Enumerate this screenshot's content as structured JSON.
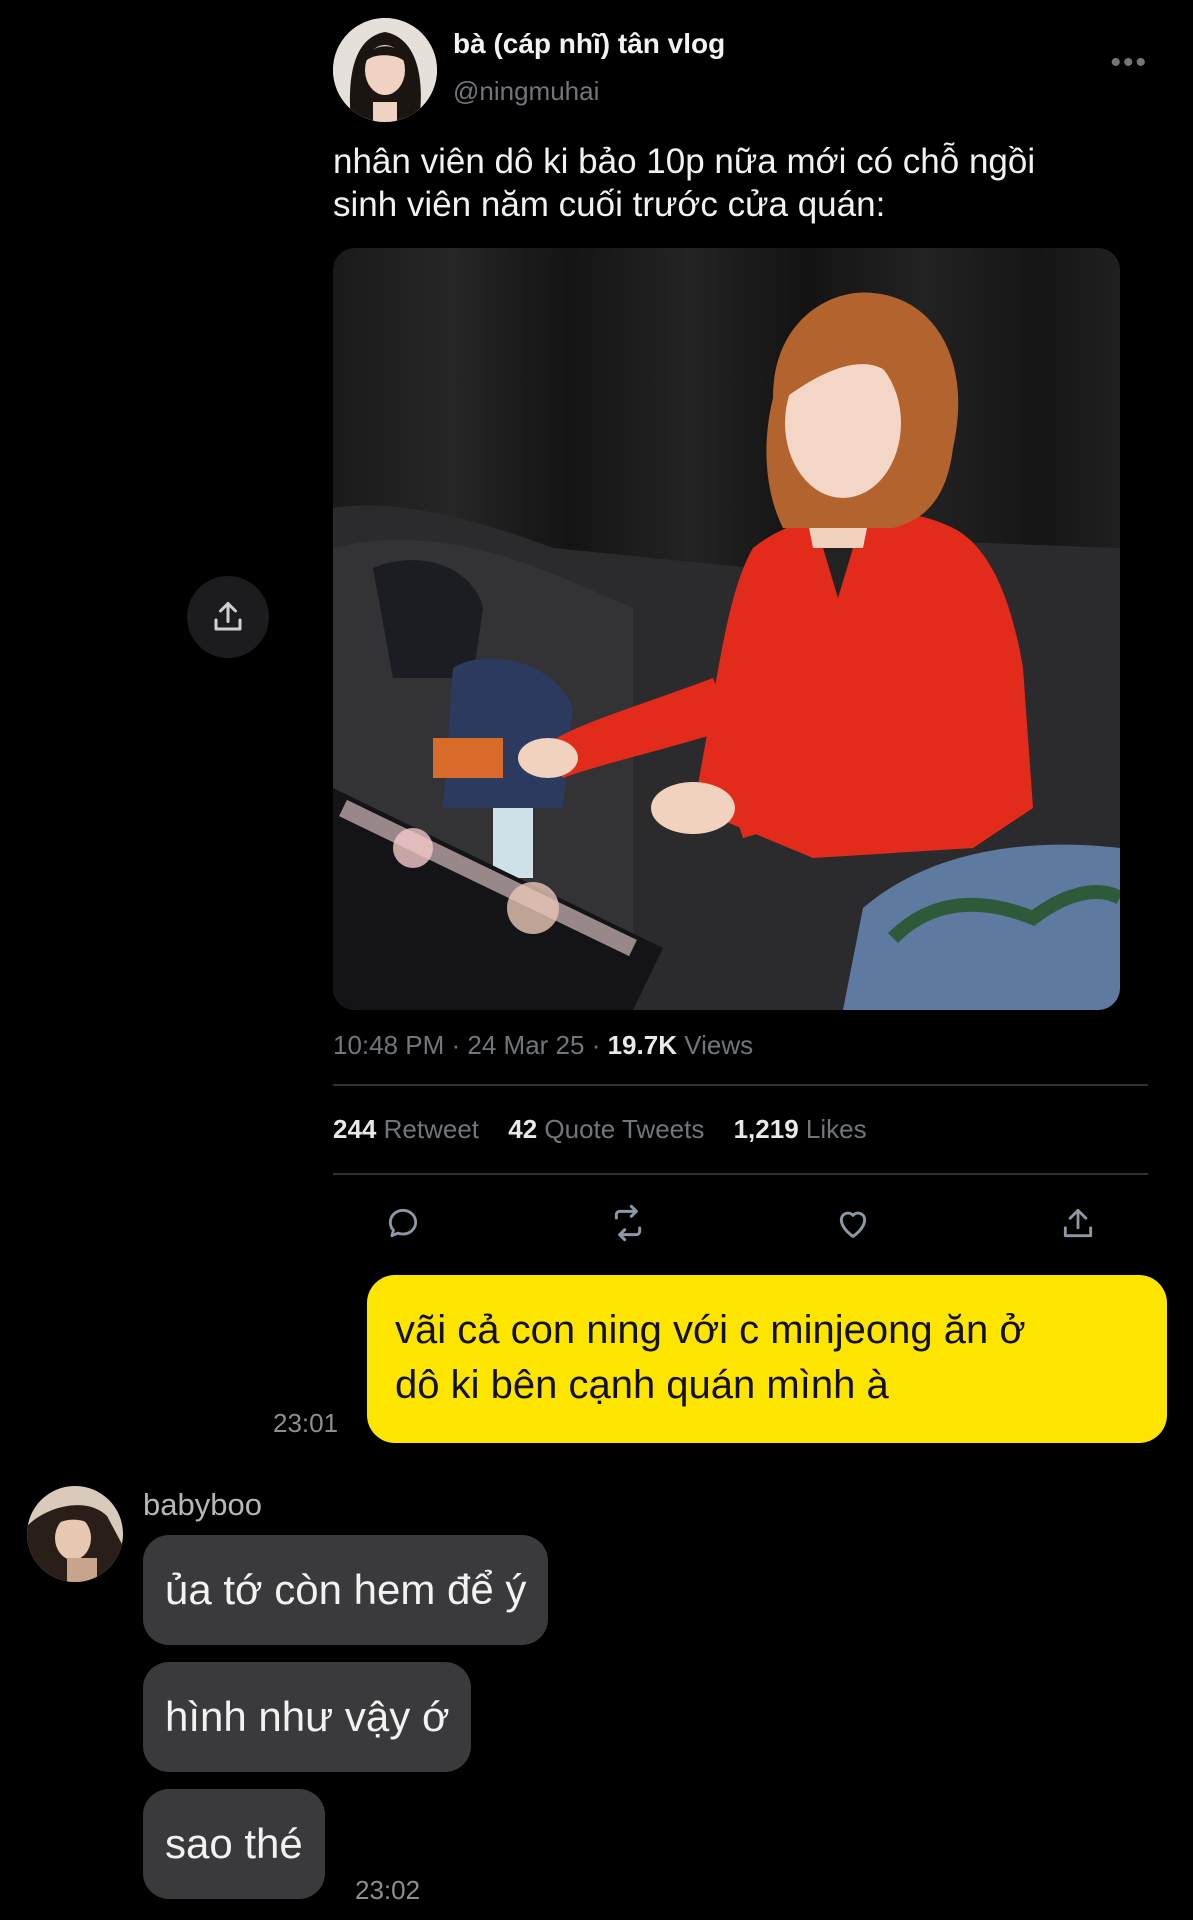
{
  "tweet": {
    "display_name": "bà (cáp nhĩ) tân vlog",
    "handle": "@ningmuhai",
    "more_icon": "more-icon",
    "text_lines": [
      "nhân viên dô ki bảo 10p nữa mới có chỗ ngồi",
      "sinh viên năm cuối trước cửa quán:"
    ],
    "time": "10:48 PM",
    "date": "24 Mar 25",
    "views_count": "19.7K",
    "views_label": "Views",
    "stats": {
      "retweets_count": "244",
      "retweets_label": "Retweet",
      "quotes_count": "42",
      "quotes_label": "Quote Tweets",
      "likes_count": "1,219",
      "likes_label": "Likes"
    },
    "actions": [
      "reply-icon",
      "retweet-icon",
      "like-icon",
      "share-icon"
    ]
  },
  "chat": {
    "outgoing": {
      "lines": [
        "vãi cả con ning với c minjeong ăn ở",
        "dô ki bên cạnh quán mình à"
      ],
      "time": "23:01",
      "color": "#fee500"
    },
    "incoming": {
      "sender": "babyboo",
      "messages": [
        "ủa tớ còn hem để ý",
        "hình như vậy ớ",
        "sao thé"
      ],
      "time": "23:02",
      "color": "#3a3a3c"
    }
  },
  "colors": {
    "background": "#000000",
    "muted": "#71767b",
    "accent_yellow": "#fee500"
  }
}
